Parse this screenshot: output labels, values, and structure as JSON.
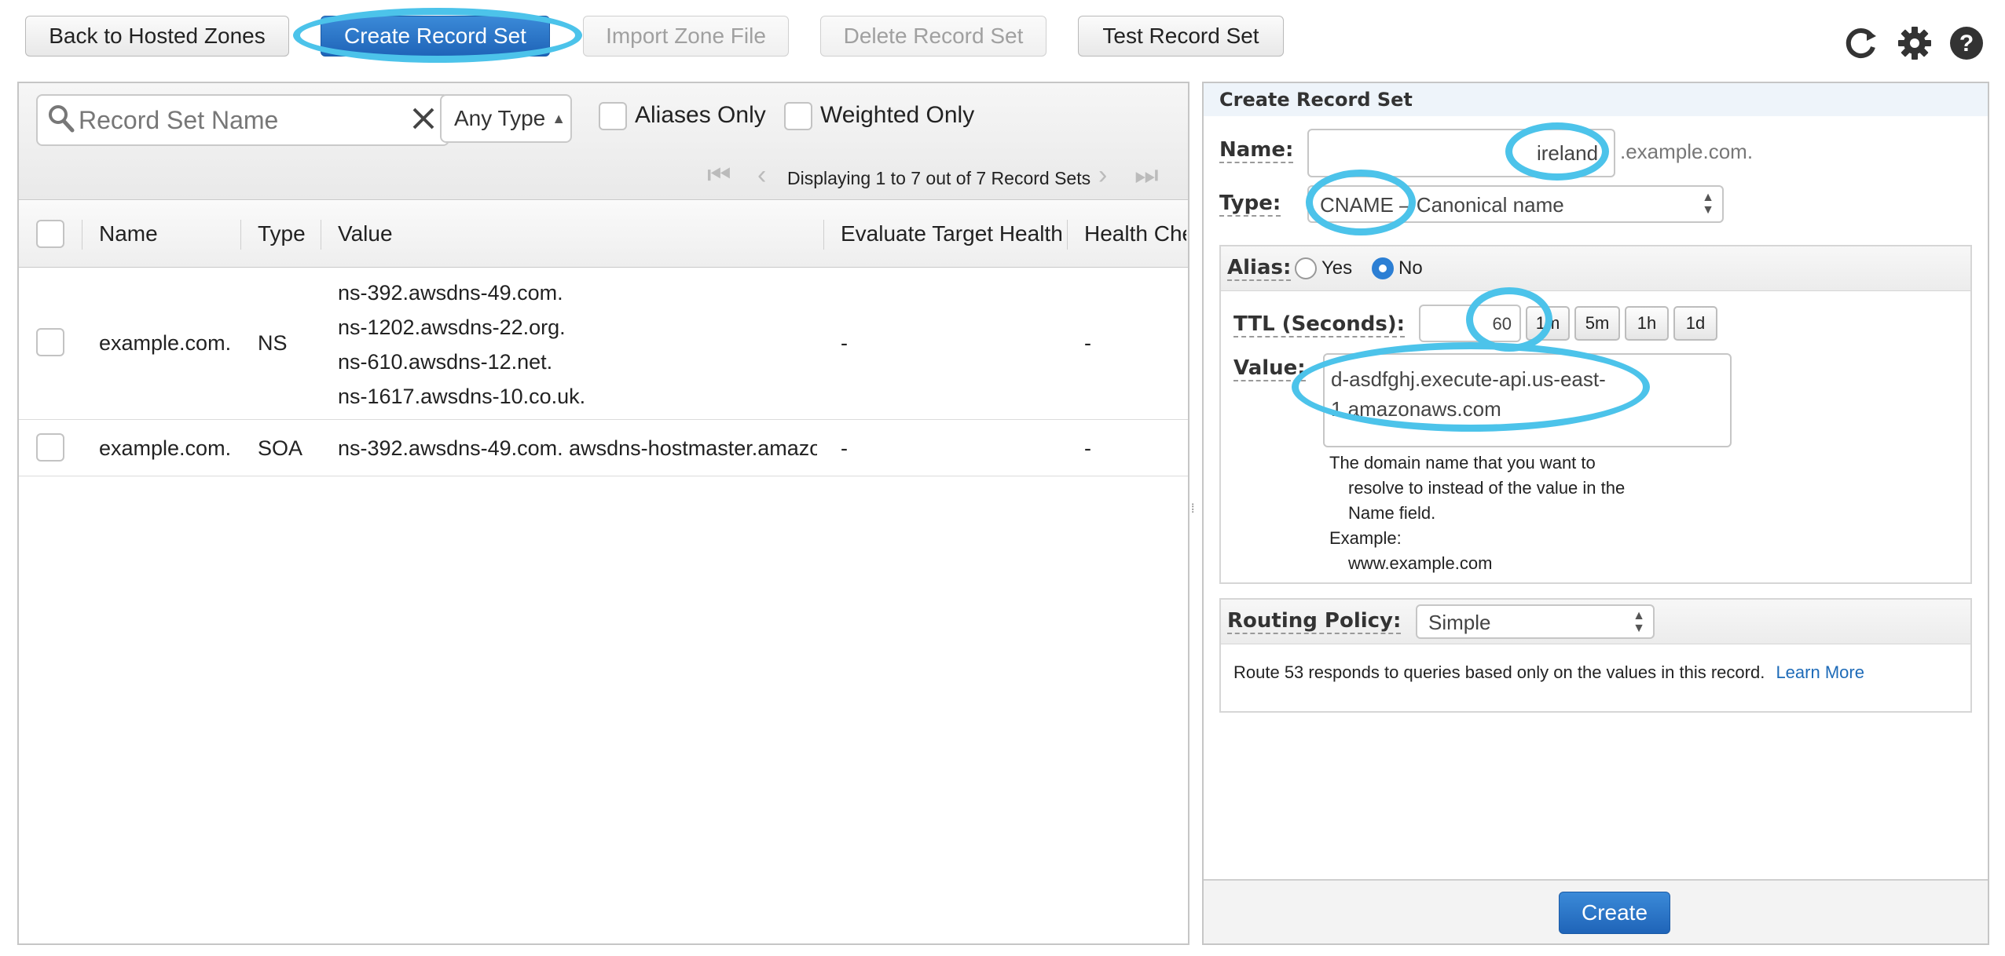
{
  "toolbar": {
    "back": "Back to Hosted Zones",
    "create": "Create Record Set",
    "import": "Import Zone File",
    "delete": "Delete Record Set",
    "test": "Test Record Set"
  },
  "icons": {
    "refresh": "refresh-icon",
    "settings": "gear-icon",
    "help": "help-icon"
  },
  "filters": {
    "search_placeholder": "Record Set Name",
    "type_select": "Any Type",
    "aliases_only": "Aliases Only",
    "weighted_only": "Weighted Only",
    "pager_text": "Displaying 1 to 7 out of 7 Record Sets"
  },
  "table": {
    "columns": [
      "Name",
      "Type",
      "Value",
      "Evaluate Target Health",
      "Health Che"
    ],
    "rows": [
      {
        "name": "example.com.",
        "type": "NS",
        "values": [
          "ns-392.awsdns-49.com.",
          "ns-1202.awsdns-22.org.",
          "ns-610.awsdns-12.net.",
          "ns-1617.awsdns-10.co.uk."
        ],
        "eval": "-",
        "health": "-"
      },
      {
        "name": "example.com.",
        "type": "SOA",
        "values": [
          "ns-392.awsdns-49.com. awsdns-hostmaster.amazor"
        ],
        "eval": "-",
        "health": "-"
      }
    ]
  },
  "form": {
    "title": "Create Record Set",
    "name_label": "Name:",
    "name_value": "ireland",
    "name_suffix": ".example.com.",
    "type_label": "Type:",
    "type_value": "CNAME – Canonical name",
    "alias_label": "Alias:",
    "alias_yes": "Yes",
    "alias_no": "No",
    "ttl_label": "TTL (Seconds):",
    "ttl_value": "60",
    "ttl_presets": [
      "1m",
      "5m",
      "1h",
      "1d"
    ],
    "value_label": "Value:",
    "value_text": "d-asdfghj.execute-api.us-east-1.amazonaws.com",
    "help_line1": "The domain name that you want to",
    "help_line2": "resolve to instead of the value in the",
    "help_line3": "Name field.",
    "help_line4": "Example:",
    "help_line5": "www.example.com",
    "routing_label": "Routing Policy:",
    "routing_value": "Simple",
    "routing_help": "Route 53 responds to queries based only on the values in this record.",
    "learn_more": "Learn More",
    "create_button": "Create"
  },
  "colors": {
    "highlight": "#4cc3ea",
    "primary": "#1f64b8",
    "link": "#1e6bb8"
  }
}
